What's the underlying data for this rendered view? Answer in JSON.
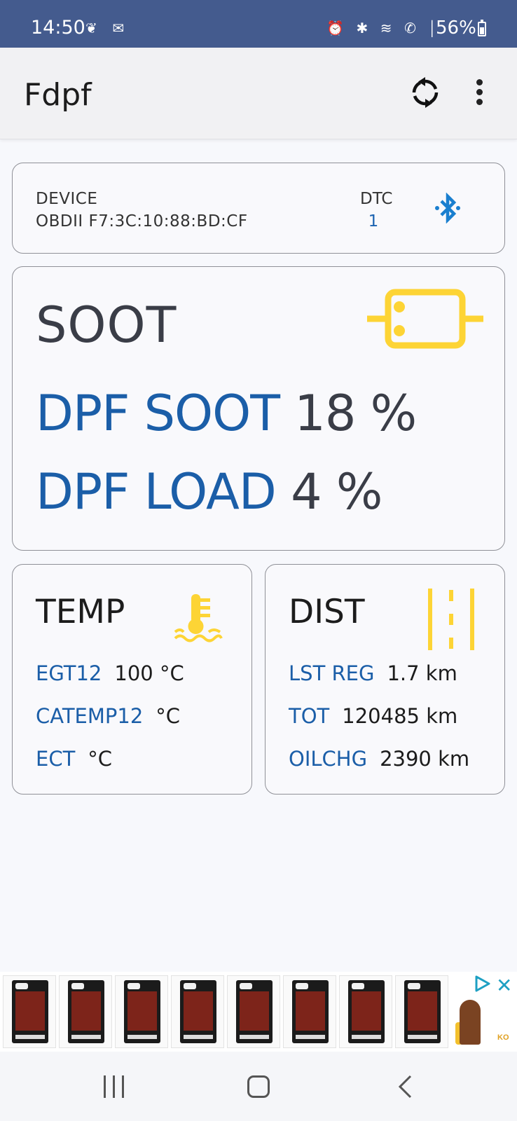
{
  "status_bar": {
    "time": "14:50",
    "left_icons": "❦ ✉",
    "right_icons": "⏰ ✱ ≋ ✆ │",
    "battery_text": "56%",
    "battery_level": 0.56,
    "color": "#445b8e"
  },
  "app_bar": {
    "title": "Fdpf",
    "sync_icon": "sync-icon",
    "menu_icon": "more-vert-icon"
  },
  "device_card": {
    "device_label": "DEVICE",
    "device_value": "OBDII F7:3C:10:88:BD:CF",
    "dtc_label": "DTC",
    "dtc_value": "1",
    "bluetooth_icon": "bluetooth-icon"
  },
  "soot_card": {
    "title": "SOOT",
    "icon": "dpf-filter-icon",
    "rows": [
      {
        "label": "DPF SOOT",
        "value": "18 %"
      },
      {
        "label": "DPF LOAD",
        "value": "4 %"
      }
    ]
  },
  "temp_card": {
    "title": "TEMP",
    "icon": "coolant-temperature-icon",
    "rows": [
      {
        "label": "EGT12",
        "value": "100 °C"
      },
      {
        "label": "CATEMP12",
        "value": "°C"
      },
      {
        "label": "ECT",
        "value": "°C"
      }
    ]
  },
  "dist_card": {
    "title": "DIST",
    "icon": "road-distance-icon",
    "rows": [
      {
        "label": "LST REG",
        "value": "1.7 km"
      },
      {
        "label": "TOT",
        "value": "120485 km"
      },
      {
        "label": "OILCHG",
        "value": "2390 km"
      }
    ]
  },
  "ad_banner": {
    "close_icon": "ad-close-icon",
    "info_icon": "ad-choices-icon",
    "brand_text": "KO",
    "close_symbol": "✕"
  },
  "colors": {
    "accent_blue": "#1b5ea8",
    "icon_yellow": "#fdd435",
    "bluetooth_blue": "#1a7fcf",
    "value_gray": "#3a3d47"
  }
}
